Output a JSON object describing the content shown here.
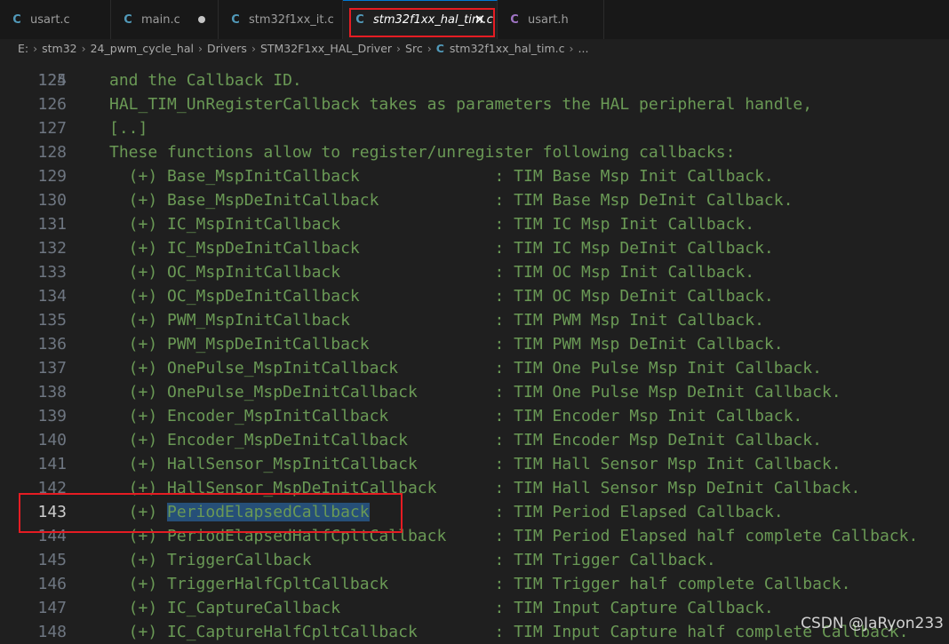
{
  "tabs": [
    {
      "icon": "C",
      "icon_type": "c-file-icon",
      "label": "usart.c",
      "active": false,
      "modified": false
    },
    {
      "icon": "C",
      "icon_type": "c-file-icon",
      "label": "main.c",
      "active": false,
      "modified": true
    },
    {
      "icon": "C",
      "icon_type": "c-file-icon",
      "label": "stm32f1xx_it.c",
      "active": false,
      "modified": false
    },
    {
      "icon": "C",
      "icon_type": "c-file-icon",
      "label": "stm32f1xx_hal_tim.c",
      "active": true,
      "modified": false
    },
    {
      "icon": "C",
      "icon_type": "h-file-icon",
      "label": "usart.h",
      "active": false,
      "modified": false
    }
  ],
  "close_glyph": "✕",
  "breadcrumb": {
    "parts": [
      "E:",
      "stm32",
      "24_pwm_cycle_hal",
      "Drivers",
      "STM32F1xx_HAL_Driver",
      "Src"
    ],
    "file_icon": "C",
    "file": "stm32f1xx_hal_tim.c",
    "tail": "..."
  },
  "editor": {
    "partial_top_line": {
      "number": "124",
      "text": "HAL_TIM_UnRegisterCallback takes as parameters the HAL peripheral handle,"
    },
    "lines": [
      {
        "number": "125",
        "text": "and the Callback ID."
      },
      {
        "number": "126",
        "text": ""
      },
      {
        "number": "127",
        "text": "[..]"
      },
      {
        "number": "128",
        "text": "These functions allow to register/unregister following callbacks:"
      },
      {
        "number": "129",
        "text": "  (+) Base_MspInitCallback              : TIM Base Msp Init Callback."
      },
      {
        "number": "130",
        "text": "  (+) Base_MspDeInitCallback            : TIM Base Msp DeInit Callback."
      },
      {
        "number": "131",
        "text": "  (+) IC_MspInitCallback                : TIM IC Msp Init Callback."
      },
      {
        "number": "132",
        "text": "  (+) IC_MspDeInitCallback              : TIM IC Msp DeInit Callback."
      },
      {
        "number": "133",
        "text": "  (+) OC_MspInitCallback                : TIM OC Msp Init Callback."
      },
      {
        "number": "134",
        "text": "  (+) OC_MspDeInitCallback              : TIM OC Msp DeInit Callback."
      },
      {
        "number": "135",
        "text": "  (+) PWM_MspInitCallback               : TIM PWM Msp Init Callback."
      },
      {
        "number": "136",
        "text": "  (+) PWM_MspDeInitCallback             : TIM PWM Msp DeInit Callback."
      },
      {
        "number": "137",
        "text": "  (+) OnePulse_MspInitCallback          : TIM One Pulse Msp Init Callback."
      },
      {
        "number": "138",
        "text": "  (+) OnePulse_MspDeInitCallback        : TIM One Pulse Msp DeInit Callback."
      },
      {
        "number": "139",
        "text": "  (+) Encoder_MspInitCallback           : TIM Encoder Msp Init Callback."
      },
      {
        "number": "140",
        "text": "  (+) Encoder_MspDeInitCallback         : TIM Encoder Msp DeInit Callback."
      },
      {
        "number": "141",
        "text": "  (+) HallSensor_MspInitCallback        : TIM Hall Sensor Msp Init Callback."
      },
      {
        "number": "142",
        "text": "  (+) HallSensor_MspDeInitCallback      : TIM Hall Sensor Msp DeInit Callback."
      },
      {
        "number": "143",
        "text": "  (+) PeriodElapsedCallback             : TIM Period Elapsed Callback.",
        "selected": "PeriodElapsedCallback",
        "current": true
      },
      {
        "number": "144",
        "text": "  (+) PeriodElapsedHalfCpltCallback     : TIM Period Elapsed half complete Callback."
      },
      {
        "number": "145",
        "text": "  (+) TriggerCallback                   : TIM Trigger Callback."
      },
      {
        "number": "146",
        "text": "  (+) TriggerHalfCpltCallback           : TIM Trigger half complete Callback."
      },
      {
        "number": "147",
        "text": "  (+) IC_CaptureCallback                : TIM Input Capture Callback."
      },
      {
        "number": "148",
        "text": "  (+) IC_CaptureHalfCpltCallback        : TIM Input Capture half complete Callback."
      }
    ]
  },
  "watermark": "CSDN @JaRyon233",
  "colors": {
    "comment": "#6a9955",
    "selection": "#264f78",
    "annotation_box": "#e51c23",
    "c_icon": "#519aba",
    "h_icon": "#a074c4"
  }
}
